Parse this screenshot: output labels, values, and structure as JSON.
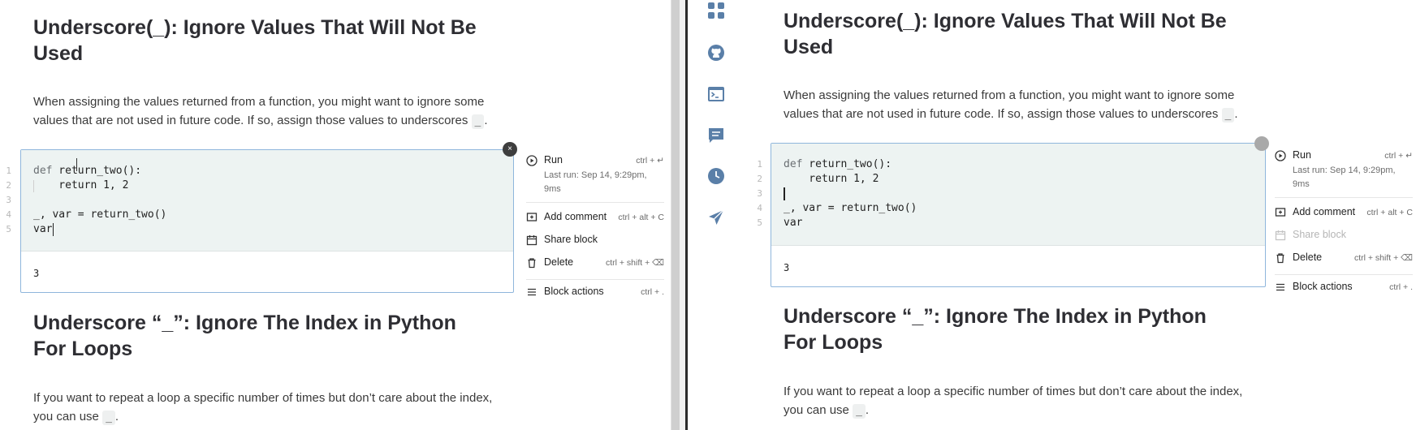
{
  "left": {
    "heading1": "Underscore(_): Ignore Values That Will Not Be Used",
    "para1_text": "When assigning the values returned from a function, you might want to ignore some values that are not used in future code. If so, assign those values to underscores",
    "para1_code": "_",
    "para1_end": ".",
    "code_lines": [
      {
        "num": "1",
        "kw": "def",
        "text": " return_two():"
      },
      {
        "num": "2",
        "kw": "",
        "text": "    return 1, 2"
      },
      {
        "num": "3",
        "kw": "",
        "text": ""
      },
      {
        "num": "4",
        "kw": "",
        "text": "_, var = return_two()"
      },
      {
        "num": "5",
        "kw": "",
        "text": "var"
      }
    ],
    "output": "3",
    "close_glyph": "×",
    "heading2": "Underscore “_”: Ignore The Index in Python For Loops",
    "para2_text": "If you want to repeat a loop a specific number of times but don’t care about the index, you can use",
    "para2_code": "_",
    "para2_end": ".",
    "menu": {
      "run_label": "Run",
      "run_shortcut": "ctrl + ↵",
      "last_run": "Last run: Sep 14, 9:29pm, 9ms",
      "add_comment_label": "Add comment",
      "add_comment_shortcut": "ctrl + alt + C",
      "share_block_label": "Share block",
      "delete_label": "Delete",
      "delete_shortcut": "ctrl + shift + ⌫",
      "block_actions_label": "Block actions",
      "block_actions_shortcut": "ctrl + ."
    }
  },
  "right": {
    "heading1": "Underscore(_): Ignore Values That Will Not Be Used",
    "para1_text": "When assigning the values returned from a function, you might want to ignore some values that are not used in future code. If so, assign those values to underscores",
    "para1_code": "_",
    "para1_end": ".",
    "code_lines": [
      {
        "num": "1",
        "kw": "def",
        "text": " return_two():"
      },
      {
        "num": "2",
        "kw": "",
        "text": "    return 1, 2"
      },
      {
        "num": "3",
        "kw": "",
        "text": ""
      },
      {
        "num": "4",
        "kw": "",
        "text": "_, var = return_two()"
      },
      {
        "num": "5",
        "kw": "",
        "text": "var"
      }
    ],
    "output": "3",
    "heading2": "Underscore “_”: Ignore The Index in Python For Loops",
    "para2_text": "If you want to repeat a loop a specific number of times but don’t care about the index, you can use",
    "para2_code": "_",
    "para2_end": ".",
    "menu": {
      "run_label": "Run",
      "run_shortcut": "ctrl + ↵",
      "last_run": "Last run: Sep 14, 9:29pm, 9ms",
      "add_comment_label": "Add comment",
      "add_comment_shortcut": "ctrl + alt + C",
      "share_block_label": "Share block",
      "delete_label": "Delete",
      "delete_shortcut": "ctrl + shift + ⌫",
      "block_actions_label": "Block actions",
      "block_actions_shortcut": "ctrl + ."
    },
    "rail_icons": [
      "apps-grid-icon",
      "github-icon",
      "terminal-icon",
      "comments-icon",
      "history-clock-icon",
      "send-icon"
    ],
    "accent_color": "#5a7fa8"
  }
}
